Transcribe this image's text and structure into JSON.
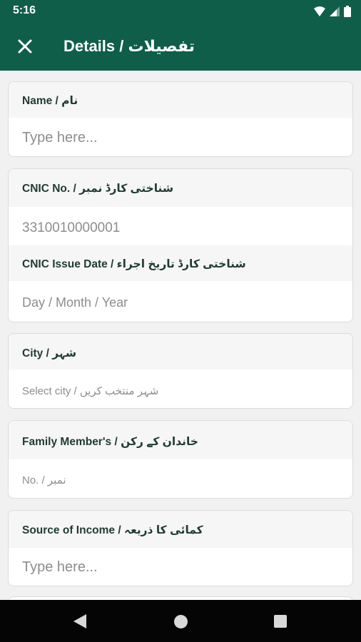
{
  "status_bar": {
    "time": "5:16"
  },
  "header": {
    "title": "Details / تفصیلات"
  },
  "form": {
    "name": {
      "label": "Name / نام",
      "placeholder": "Type here..."
    },
    "cnic_no": {
      "label": "CNIC No. / شناختی کارڈ نمبر",
      "value": "3310010000001"
    },
    "cnic_issue_date": {
      "label": "CNIC Issue Date / شناختی کارڈ تاریخ اجراء",
      "placeholder": "Day / Month / Year"
    },
    "city": {
      "label": "City / شہر",
      "placeholder": "Select city / شہر منتخب کریں"
    },
    "family_members": {
      "label": "Family Member's / خاندان کے رکن",
      "placeholder": "No. / نمبر"
    },
    "source_of_income": {
      "label": "Source of Income / کمائی کا ذریعہ",
      "placeholder": "Type here..."
    }
  },
  "colors": {
    "primary": "#0f5e4a",
    "label_text": "#1f3b33",
    "placeholder": "#8d8d8d"
  }
}
